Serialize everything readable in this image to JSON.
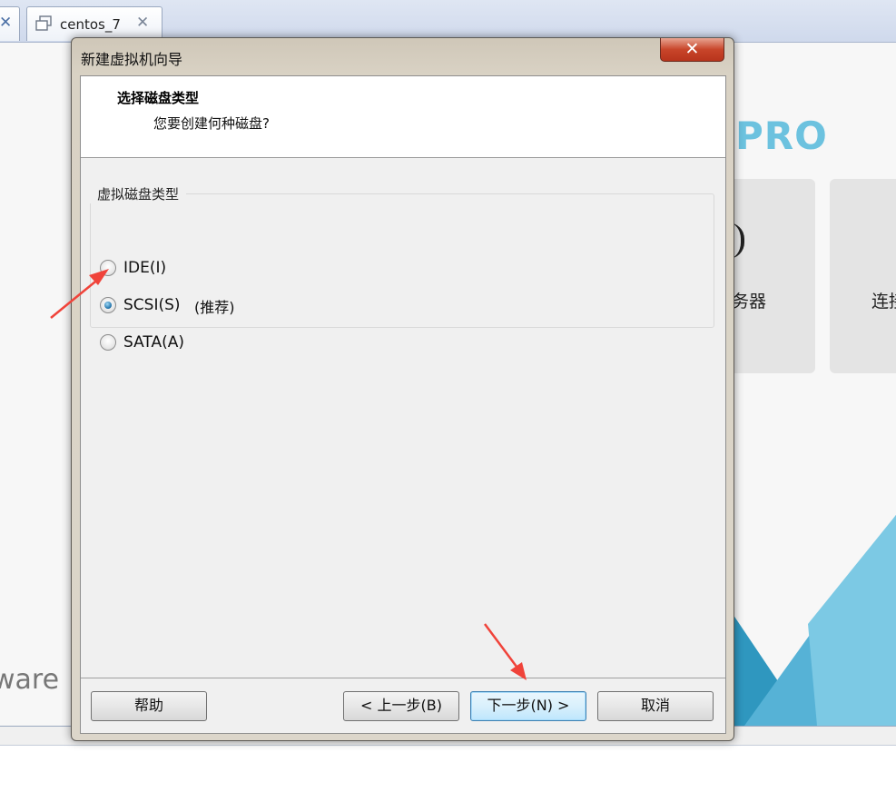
{
  "app_tabs": [
    {
      "label": "",
      "close_glyph": "✕"
    },
    {
      "label": "centos_7",
      "close_glyph": "✕"
    }
  ],
  "home": {
    "logo_text": "PRO",
    "cards": [
      {
        "label": "务器"
      },
      {
        "label": "连接"
      }
    ],
    "brand_text": "ware"
  },
  "dialog": {
    "title": "新建虚拟机向导",
    "close_glyph": "✕",
    "header": {
      "title": "选择磁盘类型",
      "subtitle": "您要创建何种磁盘?"
    },
    "group": {
      "title": "虚拟磁盘类型",
      "options": [
        {
          "label": "IDE(I)",
          "checked": false
        },
        {
          "label": "SCSI(S)",
          "note": "(推荐)",
          "checked": true
        },
        {
          "label": "SATA(A)",
          "checked": false
        }
      ]
    },
    "buttons": {
      "help": "帮助",
      "back": "< 上一步(B)",
      "next": "下一步(N) >",
      "cancel": "取消"
    }
  },
  "colors": {
    "accent": "#6cc2df",
    "annotation_arrow": "#f0433a",
    "close_button": "#c8452a"
  }
}
